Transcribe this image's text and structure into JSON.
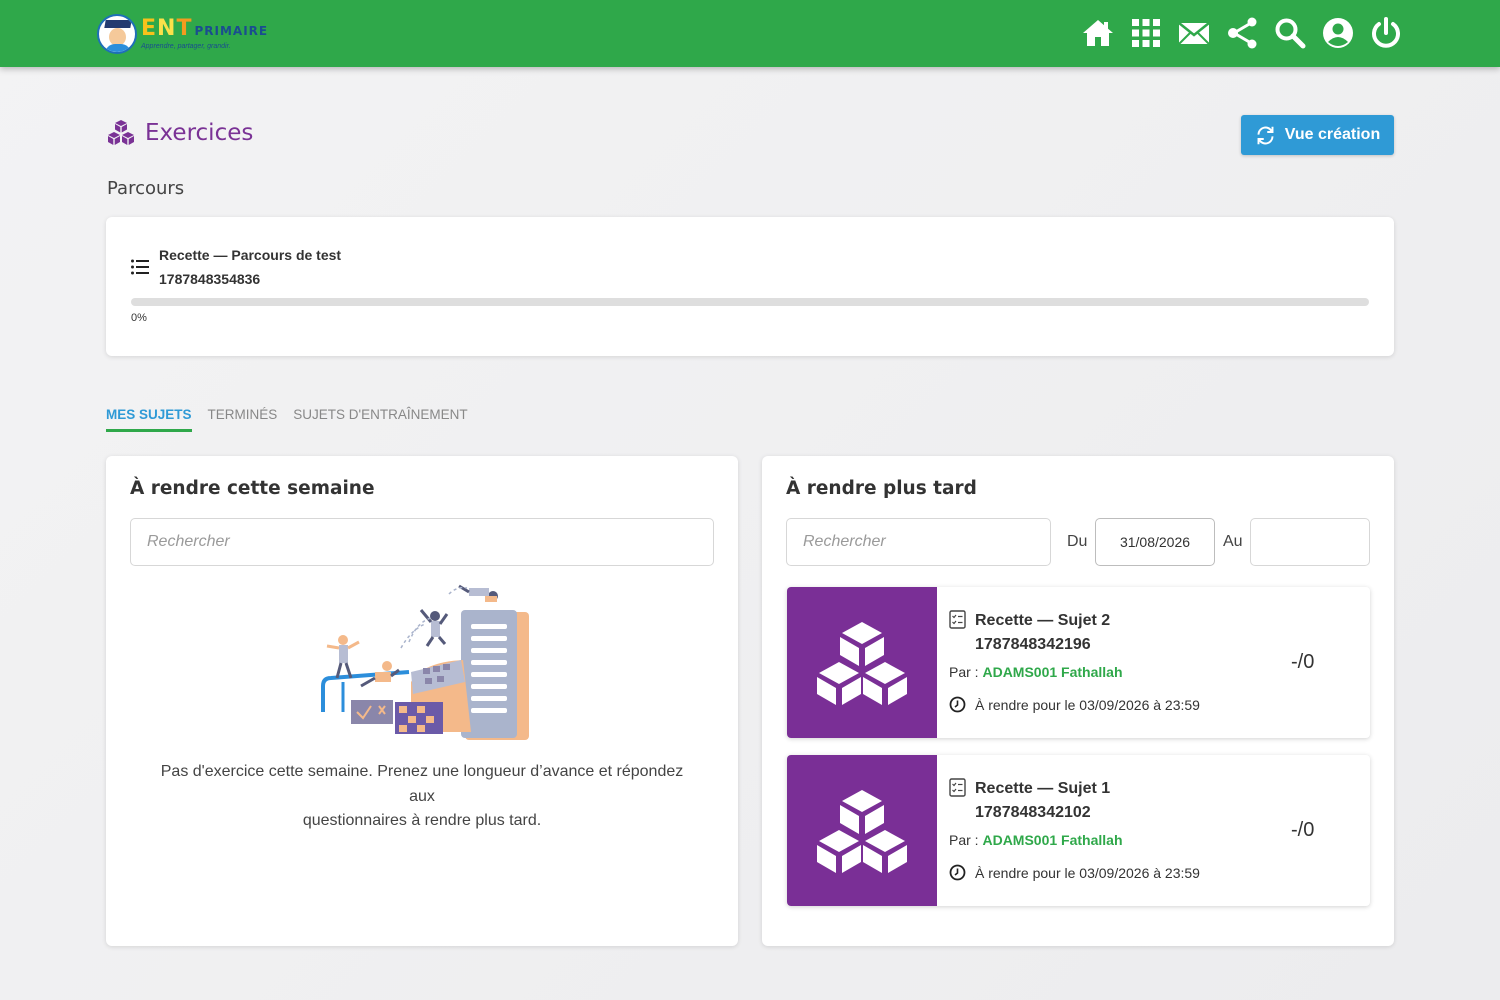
{
  "header": {
    "logo": {
      "brand": "ENT",
      "sub": "PRIMAIRE",
      "tagline": "Apprendre, partager, grandir."
    },
    "nav_icons": [
      "home-icon",
      "apps-grid-icon",
      "mail-icon",
      "share-icon",
      "search-icon",
      "user-account-icon",
      "power-icon"
    ]
  },
  "page": {
    "title": "Exercices",
    "vue_creation_label": "Vue création",
    "parcours_heading": "Parcours"
  },
  "parcours": {
    "name_line1": "Recette — Parcours de test",
    "name_line2": "1787848354836",
    "progress": 0,
    "progress_label": "0%"
  },
  "tabs": [
    {
      "label": "MES SUJETS",
      "active": true
    },
    {
      "label": "TERMINÉS",
      "active": false
    },
    {
      "label": "SUJETS D'ENTRAÎNEMENT",
      "active": false
    }
  ],
  "this_week": {
    "title": "À rendre cette semaine",
    "search_placeholder": "Rechercher",
    "empty_line1": "Pas d'exercice cette semaine. Prenez une longueur d’avance et répondez aux",
    "empty_line2": "questionnaires à rendre plus tard."
  },
  "later": {
    "title": "À rendre plus tard",
    "search_placeholder": "Rechercher",
    "du_label": "Du",
    "du_value": "31/08/2026",
    "au_label": "Au",
    "au_value": "",
    "subjects": [
      {
        "title_line1": "Recette — Sujet 2",
        "title_line2": "1787848342196",
        "par_label": "Par : ",
        "author": "ADAMS001 Fathallah",
        "due": "À rendre pour le 03/09/2026 à 23:59",
        "score": "-/0"
      },
      {
        "title_line1": "Recette — Sujet 1",
        "title_line2": "1787848342102",
        "par_label": "Par : ",
        "author": "ADAMS001 Fathallah",
        "due": "À rendre pour le 03/09/2026 à 23:59",
        "score": "-/0"
      }
    ]
  },
  "colors": {
    "topbar": "#2fa84a",
    "accent_purple": "#7a3295",
    "button_blue": "#2f9ad6",
    "author_green": "#2fa84a",
    "thumb_purple": "#7a2f96"
  }
}
